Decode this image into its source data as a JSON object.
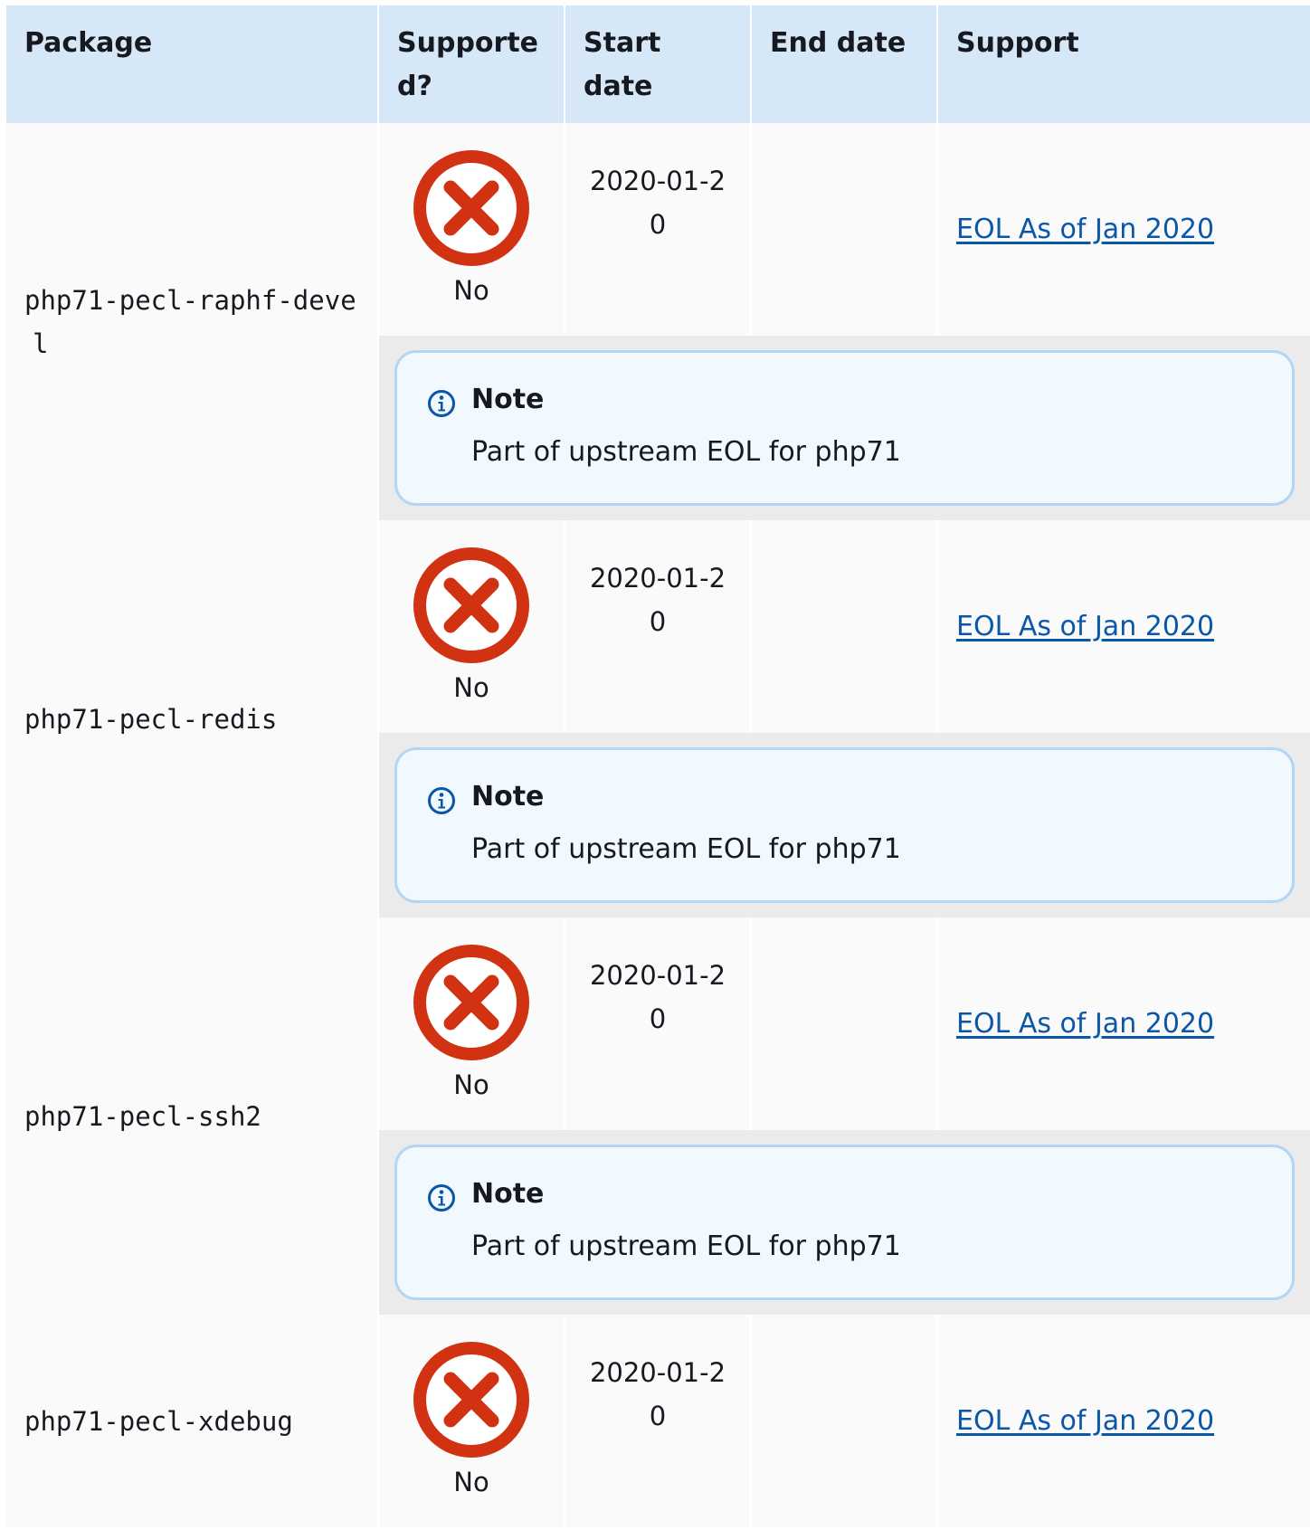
{
  "table": {
    "headers": [
      "Package",
      "Supported?",
      "Start date",
      "End date",
      "Support"
    ],
    "rows": [
      {
        "package": "php71-pecl-raphf-devel",
        "supported": "No",
        "supported_icon": "x-circle-icon",
        "start_date": "2020-01-20",
        "end_date": "",
        "support_link": "EOL As of Jan 2020",
        "note_title": "Note",
        "note_text": "Part of upstream EOL for php71"
      },
      {
        "package": "php71-pecl-redis",
        "supported": "No",
        "supported_icon": "x-circle-icon",
        "start_date": "2020-01-20",
        "end_date": "",
        "support_link": "EOL As of Jan 2020",
        "note_title": "Note",
        "note_text": "Part of upstream EOL for php71"
      },
      {
        "package": "php71-pecl-ssh2",
        "supported": "No",
        "supported_icon": "x-circle-icon",
        "start_date": "2020-01-20",
        "end_date": "",
        "support_link": "EOL As of Jan 2020",
        "note_title": "Note",
        "note_text": "Part of upstream EOL for php71"
      },
      {
        "package": "php71-pecl-xdebug",
        "supported": "No",
        "supported_icon": "x-circle-icon",
        "start_date": "2020-01-20",
        "end_date": "",
        "support_link": "EOL As of Jan 2020",
        "note_title": "",
        "note_text": ""
      }
    ]
  },
  "colors": {
    "header_bg": "#d6e8f8",
    "row_bg": "#fafafa",
    "note_row_bg": "#ebebeb",
    "note_box_bg": "#f1f8fe",
    "note_border": "#b5d5f4",
    "x_icon_red": "#d13212",
    "link": "#0a57a8"
  }
}
